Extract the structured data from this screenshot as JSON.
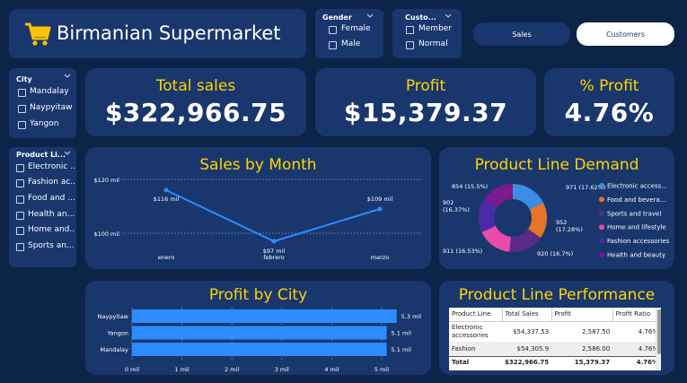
{
  "header": {
    "title": "Birmanian Supermarket",
    "logo_icon": "shopping-cart-icon"
  },
  "filters": {
    "gender": {
      "title": "Gender",
      "options": [
        "Female",
        "Male"
      ]
    },
    "customer": {
      "title": "Custo...",
      "options": [
        "Member",
        "Normal"
      ]
    },
    "city": {
      "title": "City",
      "options": [
        "Mandalay",
        "Naypyitaw",
        "Yangon"
      ]
    },
    "product_line": {
      "title": "Product Li...",
      "options": [
        "Electronic ...",
        "Fashion ac...",
        "Food and ...",
        "Health an...",
        "Home and...",
        "Sports an..."
      ]
    }
  },
  "nav": {
    "sales_label": "Sales",
    "customers_label": "Customers"
  },
  "kpis": {
    "total_sales": {
      "title": "Total sales",
      "value": "$322,966.75"
    },
    "profit": {
      "title": "Profit",
      "value": "$15,379.37"
    },
    "profit_pct": {
      "title": "% Profit",
      "value": "4.76%"
    }
  },
  "sales_by_month": {
    "title": "Sales by Month"
  },
  "product_line_demand": {
    "title": "Product Line Demand"
  },
  "profit_by_city": {
    "title": "Profit by City"
  },
  "product_line_performance": {
    "title": "Product Line Performance",
    "columns": [
      "Product Line",
      "Total Sales",
      "Profit",
      "Profit Ratio"
    ],
    "rows": [
      [
        "Electronic accessories",
        "$54,337.53",
        "2,587.50",
        "4.76%"
      ],
      [
        "Fashion",
        "$54,305.9",
        "2,586.00",
        "4.76%"
      ]
    ],
    "total": [
      "Total",
      "$322,966.75",
      "15,379.37",
      "4.76%"
    ]
  },
  "colors": {
    "background": "#0b2447",
    "card": "#19376d",
    "accent": "#ffd400",
    "line": "#2d8cff"
  },
  "chart_data": [
    {
      "type": "line",
      "title": "Sales by Month",
      "categories": [
        "enero",
        "febrero",
        "marzo"
      ],
      "values": [
        116,
        97,
        109
      ],
      "data_labels": [
        "$116 mil",
        "$97 mil",
        "$109 mil"
      ],
      "yticks": [
        "$120 mil",
        "$100 mil"
      ],
      "ylim": [
        92,
        122
      ],
      "grid": true
    },
    {
      "type": "pie",
      "title": "Product Line Demand",
      "categories": [
        "Electronic access...",
        "Food and bevera...",
        "Sports and travel",
        "Home and lifestyle",
        "Fashion accessories",
        "Health and beauty"
      ],
      "values": [
        971,
        952,
        920,
        911,
        902,
        854
      ],
      "data_labels": [
        "971 (17.62%)",
        "952 (17.28%)",
        "920 (16.7%)",
        "911 (16.53%)",
        "902 (16.37%)",
        "854 (15.5%)"
      ],
      "colors": [
        "#3a8ee6",
        "#e8742a",
        "#5b2a86",
        "#e64ca8",
        "#4b2aa8",
        "#7a1a8c"
      ],
      "legend_position": "right"
    },
    {
      "type": "bar",
      "orientation": "horizontal",
      "title": "Profit by City",
      "categories": [
        "Naypyitaw",
        "Yangon",
        "Mandalay"
      ],
      "values": [
        5.3,
        5.1,
        5.1
      ],
      "data_labels": [
        "5.3 mil",
        "5.1 mil",
        "5.1 mil"
      ],
      "xticks": [
        "0 mil",
        "1 mil",
        "2 mil",
        "3 mil",
        "4 mil",
        "5 mil"
      ],
      "xlim": [
        0,
        5
      ],
      "grid": true
    }
  ]
}
